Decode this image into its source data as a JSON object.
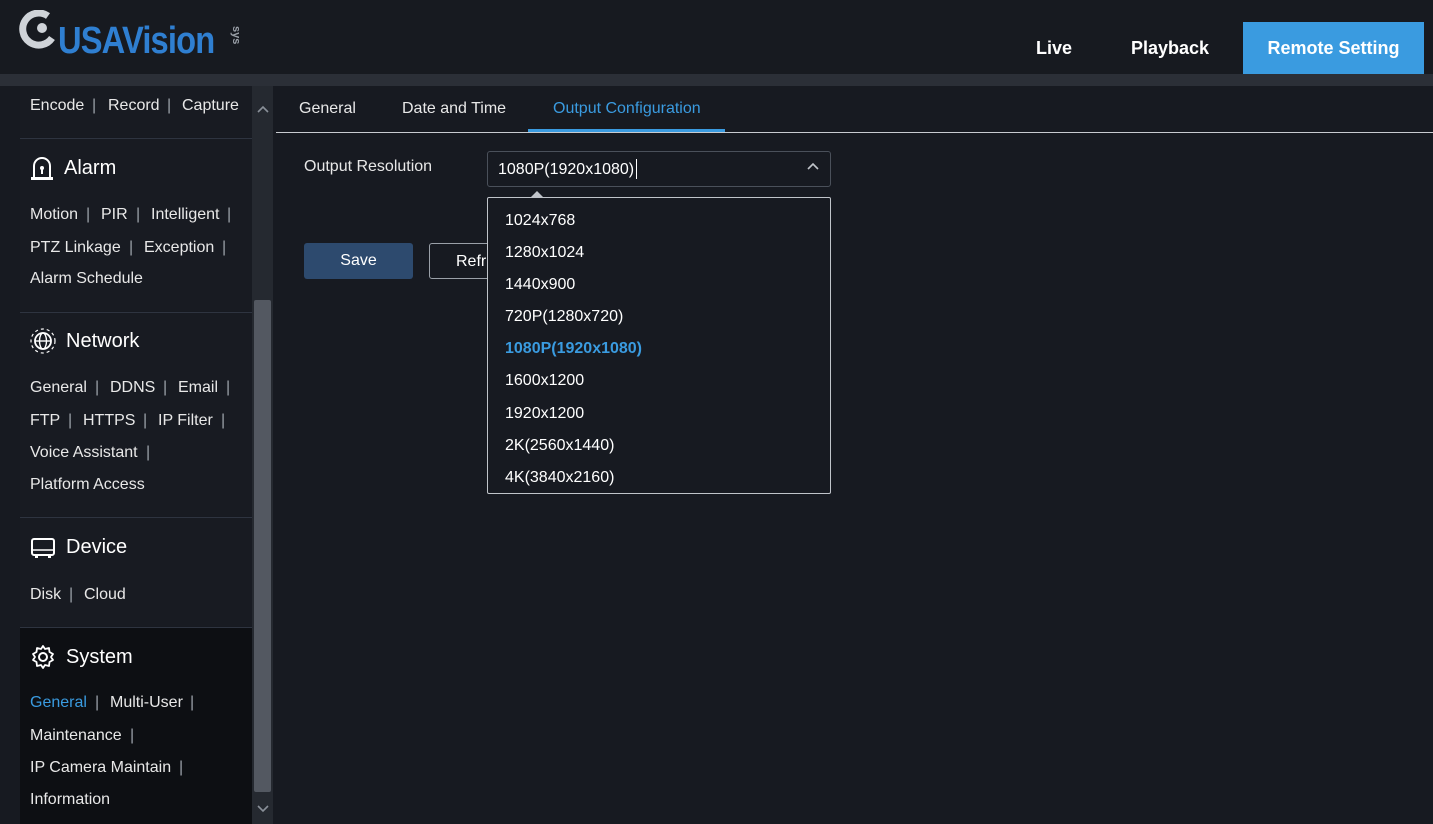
{
  "brand": {
    "name": "USAVision",
    "suffix": "sys"
  },
  "nav": {
    "live": "Live",
    "playback": "Playback",
    "remote": "Remote Setting"
  },
  "sidebar": {
    "top": {
      "encode": "Encode",
      "record": "Record",
      "capture": "Capture"
    },
    "alarm": {
      "title": "Alarm",
      "motion": "Motion",
      "pir": "PIR",
      "intelligent": "Intelligent",
      "ptz": "PTZ Linkage",
      "exception": "Exception",
      "schedule": "Alarm Schedule"
    },
    "network": {
      "title": "Network",
      "general": "General",
      "ddns": "DDNS",
      "email": "Email",
      "ftp": "FTP",
      "https": "HTTPS",
      "ipfilter": "IP Filter",
      "voice": "Voice Assistant",
      "platform": "Platform Access"
    },
    "device": {
      "title": "Device",
      "disk": "Disk",
      "cloud": "Cloud"
    },
    "system": {
      "title": "System",
      "general": "General",
      "multiuser": "Multi-User",
      "maintenance": "Maintenance",
      "ipcam": "IP Camera Maintain",
      "information": "Information"
    }
  },
  "tabs": {
    "general": "General",
    "datetime": "Date and Time",
    "output": "Output Configuration"
  },
  "form": {
    "label": "Output Resolution",
    "value": "1080P(1920x1080)",
    "save": "Save",
    "refresh": "Refr"
  },
  "options": [
    "1024x768",
    "1280x1024",
    "1440x900",
    "720P(1280x720)",
    "1080P(1920x1080)",
    "1600x1200",
    "1920x1200",
    "2K(2560x1440)",
    "4K(3840x2160)"
  ],
  "colors": {
    "accent": "#3a9be0",
    "save": "#2d4a6e"
  }
}
